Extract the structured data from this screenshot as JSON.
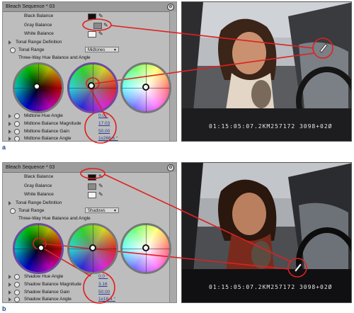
{
  "figures": [
    {
      "id": "a",
      "label": "a",
      "panel": {
        "title": "Bleach Sequence * 03",
        "black_balance_label": "Black Balance",
        "gray_balance_label": "Gray Balance",
        "white_balance_label": "White Balance",
        "tonal_range_definition_label": "Tonal Range Definition",
        "tonal_range_label": "Tonal Range",
        "tonal_range_value": "Midtones",
        "three_way_label": "Three-Way Hue Balance and Angle",
        "params": [
          {
            "label": "Midtone Hue Angle",
            "value": "0.0 °"
          },
          {
            "label": "Midtone Balance Magnitude",
            "value": "17.03"
          },
          {
            "label": "Midtone Balance Gain",
            "value": "50.00"
          },
          {
            "label": "Midtone Balance Angle",
            "value": "1x266.6 °"
          }
        ]
      },
      "timecode": "01:15:05:07.2KM257172 3098+02Ø"
    },
    {
      "id": "b",
      "label": "b",
      "panel": {
        "title": "Bleach Sequence * 03",
        "black_balance_label": "Black Balance",
        "gray_balance_label": "Gray Balance",
        "white_balance_label": "White Balance",
        "tonal_range_definition_label": "Tonal Range Definition",
        "tonal_range_label": "Tonal Range",
        "tonal_range_value": "Shadows",
        "three_way_label": "Three-Way Hue Balance and Angle",
        "params": [
          {
            "label": "Shadow Hue Angle",
            "value": "0.0 °"
          },
          {
            "label": "Shadow Balance Magnitude",
            "value": "3.16"
          },
          {
            "label": "Shadow Balance Gain",
            "value": "50.00"
          },
          {
            "label": "Shadow Balance Angle",
            "value": "1x18.4 °"
          }
        ]
      },
      "timecode": "01:15:05:07.2KM257172 3098+02Ø"
    }
  ],
  "colors": {
    "annotation": "#e02020",
    "value_link": "#2b3c8f",
    "panel_bg": "#bdbdbd",
    "figure_label": "#1b4a8a"
  },
  "icons": {
    "eyedropper": "eyedropper-icon",
    "gear": "gear-icon",
    "expand": "disclosure-triangle-icon",
    "keyframe": "keyframe-radio-icon"
  }
}
